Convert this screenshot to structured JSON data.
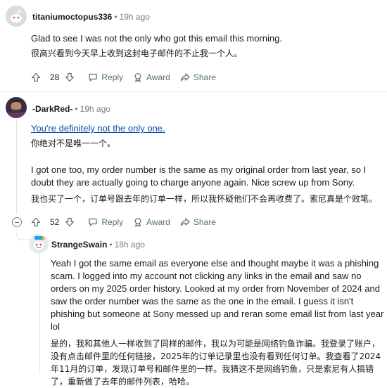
{
  "comments": [
    {
      "username": "titaniumoctopus336",
      "time": "19h ago",
      "body": [
        "Glad to see I was not the only who got this email this morning.",
        "很高兴看到今天早上收到这封电子邮件的不止我一个人。"
      ],
      "votes": "28",
      "actions": {
        "reply": "Reply",
        "award": "Award",
        "share": "Share"
      }
    },
    {
      "username": "-DarkRed-",
      "time": "19h ago",
      "body": [
        "You're definitely not the only one.",
        "你绝对不是唯一一个。",
        "I got one too, my order number is the same as my original order from last year, so I doubt they are actually going to charge anyone again. Nice screw up from Sony.",
        "我也买了一个，订单号跟去年的订单一样，所以我怀疑他们不会再收费了。索尼真是个败笔。"
      ],
      "votes": "52",
      "actions": {
        "reply": "Reply",
        "award": "Award",
        "share": "Share"
      }
    },
    {
      "username": "StrangeSwain",
      "time": "18h ago",
      "body": [
        "Yeah I got the same email as everyone else and thought maybe it was a phishing scam. I logged into my account not clicking any links in the email and saw no orders on my 2025 order history. Looked at my order from November of 2024 and saw the order number was the same as the one in the email. I guess it isn't phishing but someone at Sony messed up and reran some email list from last year lol",
        "是的，我和其他人一样收到了同样的邮件，我以为可能是网络钓鱼诈骗。我登录了账户，没有点击邮件里的任何链接，2025年的订单记录里也没有看到任何订单。我查看了2024年11月的订单，发现订单号和邮件里的一样。我猜这不是网络钓鱼，只是索尼有人搞错了，重新做了去年的邮件列表，哈哈。"
      ]
    }
  ],
  "colors": {
    "link": "#0a4a9e",
    "meta": "#7c7c7c",
    "action": "#576f76"
  }
}
